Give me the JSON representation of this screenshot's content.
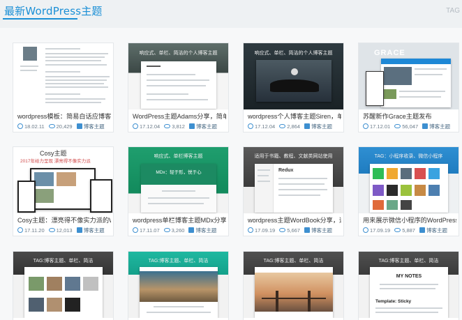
{
  "header": {
    "section_title": "最新WordPress主题",
    "tag_link": "TAG"
  },
  "cards": [
    {
      "title": "wordpress模板：简易白话应博客模板",
      "date": "18.02.11",
      "views": "20,429",
      "category": "博客主题",
      "overlay": ""
    },
    {
      "title": "WordPress主题Adams分享，简单单",
      "date": "17.12.04",
      "views": "3,812",
      "category": "博客主题",
      "overlay": "响应式、单栏、简洁的个人博客主题"
    },
    {
      "title": "wordpress个人博客主题Siren，单栏主",
      "date": "17.12.04",
      "views": "2,864",
      "category": "博客主题",
      "overlay": "响应式、单栏、简洁的个人博客主题"
    },
    {
      "title": "苏醒新作Grace主题发布",
      "date": "17.12.01",
      "views": "56,047",
      "category": "博客主题",
      "overlay": "GRACE"
    },
    {
      "title": "Cosy主题：漂亮得不像实力派的Word",
      "date": "17.11.20",
      "views": "12,013",
      "category": "博客主题",
      "overlay": "Cosy主题"
    },
    {
      "title": "wordpress单栏博客主题MDx分享",
      "date": "17.11.07",
      "views": "3,260",
      "category": "博客主题",
      "overlay": "响应式、单栏博客主题"
    },
    {
      "title": "wordpress主题WordBook分享，适用",
      "date": "17.09.19",
      "views": "5,667",
      "category": "博客主题",
      "overlay": "适用于书籍、教程、文献类网站使用"
    },
    {
      "title": "用来展示微信小程序的WordPress主题",
      "date": "17.09.19",
      "views": "5,887",
      "category": "博客主题",
      "overlay": "TAG：小程序收录、微信小程序"
    },
    {
      "title": "",
      "date": "",
      "views": "",
      "category": "",
      "overlay": "TAG:博客主题、单栏、简洁"
    },
    {
      "title": "",
      "date": "",
      "views": "",
      "category": "",
      "overlay": "TAG:博客主题、单栏、简洁"
    },
    {
      "title": "",
      "date": "",
      "views": "",
      "category": "",
      "overlay": "TAG:博客主题、单栏、简洁"
    },
    {
      "title": "",
      "date": "",
      "views": "",
      "category": "",
      "overlay": "TAG:博客主题、单栏、简洁"
    }
  ],
  "thumb_texts": {
    "cosy_slogan": "2017年给力呈现 漂亮得不像实力派",
    "mdx_tagline": "MDx：轻于形，悦于心",
    "redux_name": "Redux",
    "notes_title": "MY NOTES",
    "notes_sticky": "Template: Sticky"
  }
}
